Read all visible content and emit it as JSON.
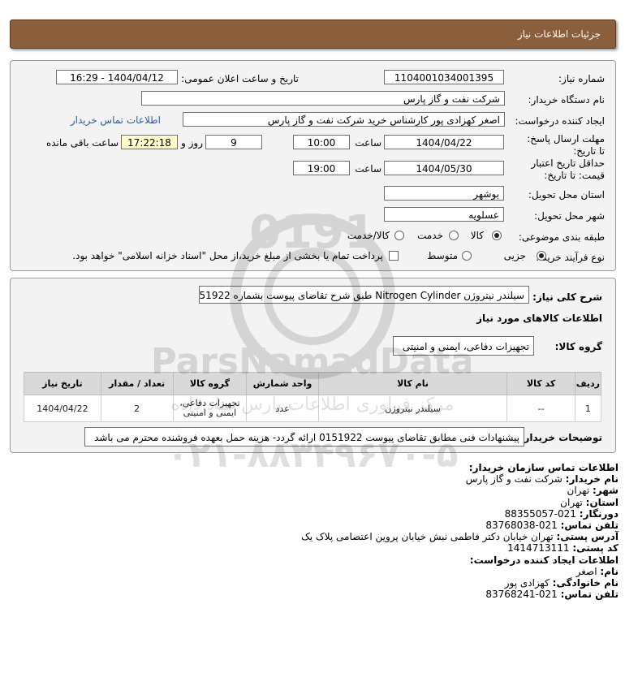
{
  "header": {
    "title": "جزئیات اطلاعات نیاز"
  },
  "form": {
    "need_number_label": "شماره نیاز:",
    "need_number": "1104001034001395",
    "announce_label": "تاریخ و ساعت اعلان عمومی:",
    "announce_value": "1404/04/12 - 16:29",
    "buyer_org_label": "نام دستگاه خریدار:",
    "buyer_org": "شرکت نفت و گاز پارس",
    "creator_label": "ایجاد کننده درخواست:",
    "creator": "اصغر کهزادی پور کارشناس خرید شرکت نفت و گاز پارس",
    "contact_link": "اطلاعات تماس خریدار",
    "deadline_label": "مهلت ارسال پاسخ: تا تاریخ:",
    "deadline_date": "1404/04/22",
    "hour_label": "ساعت",
    "deadline_time": "10:00",
    "days": "9",
    "days_label": "روز و",
    "remaining": "17:22:18",
    "remaining_label": "ساعت باقی مانده",
    "validity_label": "حداقل تاریخ اعتبار قیمت: تا تاریخ:",
    "validity_date": "1404/05/30",
    "validity_time": "19:00",
    "province_label": "استان محل تحویل:",
    "province": "بوشهر",
    "city_label": "شهر محل تحویل:",
    "city": "عسلویه",
    "category_label": "طبقه بندی موضوعی:",
    "category_options": [
      "کالا",
      "خدمت",
      "کالا/خدمت"
    ],
    "process_label": "نوع فرآیند خرید :",
    "process_options": [
      "جزیی",
      "متوسط"
    ],
    "payment_note": "پرداخت تمام یا بخشی از مبلغ خرید،از محل \"اسناد خزانه اسلامی\" خواهد بود."
  },
  "need": {
    "desc_label": "شرح کلی نیاز:",
    "desc": "سیلندر نیتروژن Nitrogen Cylinder طبق شرح تقاضای پیوست بشماره 0151922",
    "items_title": "اطلاعات کالاهای مورد نیاز",
    "group_label": "گروه کالا:",
    "group": "تجهیزات دفاعی، ایمنی و امنیتی",
    "table": {
      "headers": [
        "ردیف",
        "کد کالا",
        "نام کالا",
        "واحد شمارش",
        "گروه کالا",
        "تعداد / مقدار",
        "تاریخ نیاز"
      ],
      "rows": [
        [
          "1",
          "--",
          "سیلندر نیتروژن",
          "عدد",
          "تجهیزات دفاعی، ایمنی و امنیتی",
          "2",
          "1404/04/22"
        ]
      ]
    },
    "buyer_notes_label": "توضیحات خریدار:",
    "buyer_notes": "پیشنهادات فنی مطابق تقاضای پیوست 0151922 ارائه گردد- هزینه حمل بعهده فروشنده محترم می باشد"
  },
  "contact": {
    "org_title": "اطلاعات تماس سازمان خریدار:",
    "buyer_name_label": "نام خریدار:",
    "buyer_name": "شرکت نفت و گاز پارس",
    "city_label": "شهر:",
    "city": "تهران",
    "province_label": "استان:",
    "province": "تهران",
    "fax_label": "دورنگار:",
    "fax": "021-88355057",
    "phone_label": "تلفن تماس:",
    "phone": "021-83768038",
    "address_label": "آدرس پستی:",
    "address": "تهران خیابان دکتر فاطمی نبش خیابان پروین اعتصامی پلاک یک",
    "postal_label": "کد پستی:",
    "postal": "1414713111",
    "creator_title": "اطلاعات ایجاد کننده درخواست:",
    "first_name_label": "نام:",
    "first_name": "اصغر",
    "last_name_label": "نام خانوادگی:",
    "last_name": "کهزادی پور",
    "creator_phone_label": "تلفن تماس:",
    "creator_phone": "021-83768241"
  },
  "watermark": {
    "brand": "ParsNamadData",
    "tagline": "مرکز فراوری اطلاعات پارس نماد داده",
    "phone": "۰۲۱-۸۸۳۴۹۶۷۰-۵",
    "digits": "0191"
  }
}
